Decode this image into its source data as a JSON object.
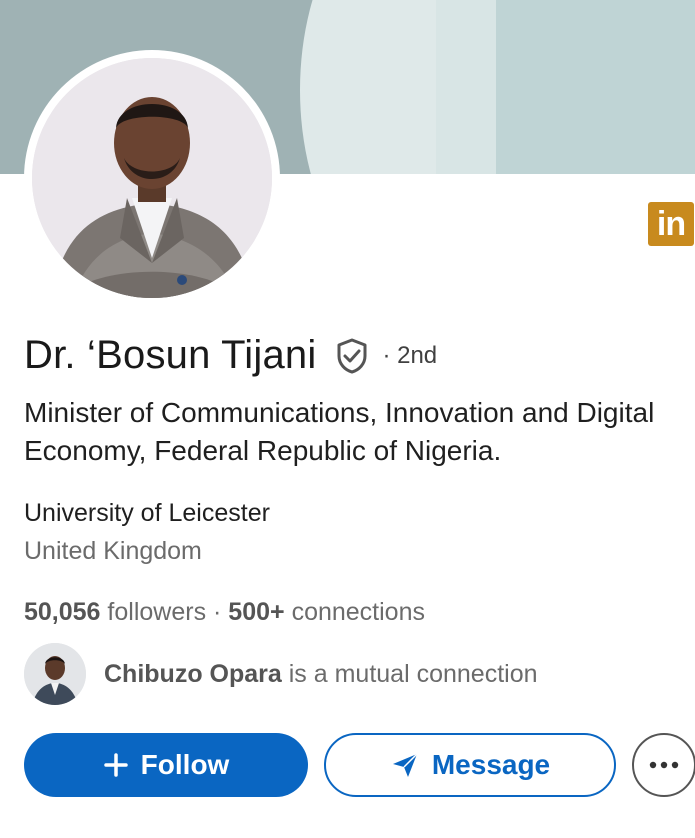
{
  "profile": {
    "name": "Dr. ‘Bosun Tijani",
    "degree": "· 2nd",
    "headline": "Minister of Communications, Innovation and Digital Economy, Federal Republic of Nigeria.",
    "school": "University of Leicester",
    "location": "United Kingdom",
    "followers_count": "50,056",
    "followers_label": "followers",
    "separator": " · ",
    "connections_count": "500+",
    "connections_label": "connections"
  },
  "mutual": {
    "name": "Chibuzo Opara",
    "text": "is a mutual connection"
  },
  "badges": {
    "linkedin_logo_text": "in"
  },
  "actions": {
    "follow_label": "Follow",
    "message_label": "Message"
  },
  "icons": {
    "verified": "shield-check-icon",
    "follow": "plus-icon",
    "message": "send-icon",
    "more": "more-horizontal-icon"
  },
  "colors": {
    "primary": "#0a66c2",
    "linkedin_badge": "#c88a1e"
  }
}
